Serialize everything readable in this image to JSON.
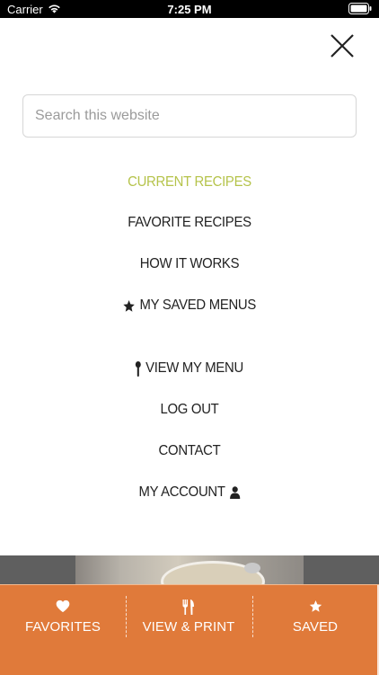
{
  "status_bar": {
    "carrier": "Carrier",
    "time": "7:25 PM"
  },
  "search": {
    "placeholder": "Search this website"
  },
  "menu": {
    "items": [
      {
        "label": "CURRENT RECIPES"
      },
      {
        "label": "FAVORITE RECIPES"
      },
      {
        "label": "HOW IT WORKS"
      },
      {
        "label": "MY SAVED MENUS",
        "icon": "star-icon"
      },
      {
        "label": "VIEW MY MENU",
        "icon": "spoon-icon"
      },
      {
        "label": "LOG OUT"
      },
      {
        "label": "CONTACT"
      },
      {
        "label": "MY ACCOUNT",
        "icon": "user-icon"
      }
    ]
  },
  "tab_bar": {
    "tabs": [
      {
        "label": "FAVORITES",
        "icon": "heart-icon"
      },
      {
        "label": "VIEW & PRINT",
        "icon": "fork-knife-icon"
      },
      {
        "label": "SAVED",
        "icon": "star-icon"
      }
    ]
  },
  "colors": {
    "accent_green": "#b5c34a",
    "tab_bar_orange": "#e07a3a",
    "menu_text": "#222222"
  }
}
